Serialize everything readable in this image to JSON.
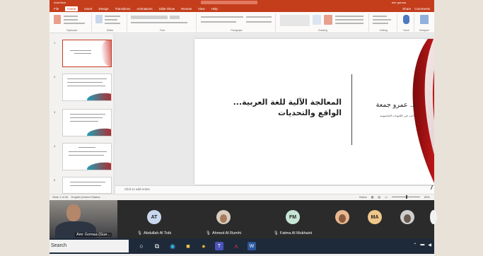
{
  "app": {
    "autosave_label": "AutoSave",
    "user_label": "amr gomaa",
    "tabs": [
      "File",
      "Home",
      "Insert",
      "Design",
      "Transitions",
      "Animations",
      "Slide Show",
      "Review",
      "View",
      "Help"
    ],
    "active_tab": "Home",
    "share_label": "Share",
    "comments_label": "Comments",
    "ribbon_groups": [
      "Clipboard",
      "Slides",
      "Font",
      "Paragraph",
      "Drawing",
      "Editing",
      "Voice",
      "Designer"
    ],
    "ribbon_buttons": {
      "paste": "Paste",
      "cut": "Cut",
      "copy": "Copy",
      "format_painter": "Format Painter",
      "new_slide": "New Slide",
      "layout": "Layout",
      "reset": "Reset",
      "section": "Section",
      "find": "Find",
      "replace": "Replace",
      "select": "Select",
      "dictate": "Dictate",
      "design_ideas": "Design Ideas"
    }
  },
  "slide": {
    "title_line1": "المعالجة الآلية للغة العربية...",
    "title_line2": "الواقع والتحديات",
    "author": "د. عمرو جمعة",
    "subtitle": "باحث في اللغويات الحاسوبية"
  },
  "thumbnails": {
    "numbers": [
      "1",
      "2",
      "3",
      "4",
      "5"
    ]
  },
  "notes_placeholder": "Click to add notes",
  "status": {
    "slide_info": "Slide 1 of 40",
    "language": "English (United States)",
    "notes": "Notes",
    "zoom": "85%"
  },
  "call": {
    "self_name": "Amr Gomaa (Gue...",
    "participants": [
      {
        "initials": "AT",
        "name": "Abdullah Al Tobi",
        "color": "#c9d8ee"
      },
      {
        "initials": "",
        "name": "Ahmed Al Rumhi",
        "color": "#d8cdbf"
      },
      {
        "initials": "FM",
        "name": "Fatma Al Mukhaini",
        "color": "#c7e5d6"
      }
    ],
    "extra_avatars": [
      {
        "initials": "",
        "color": "#e7b88f"
      },
      {
        "initials": "MA",
        "color": "#f0c78a"
      },
      {
        "initials": "",
        "color": "#cfcfcf"
      }
    ]
  },
  "taskbar": {
    "search_label": "Search",
    "icons": [
      "windows-start",
      "task-view",
      "edge",
      "file-explorer",
      "chrome",
      "teams",
      "acrobat",
      "word"
    ]
  }
}
